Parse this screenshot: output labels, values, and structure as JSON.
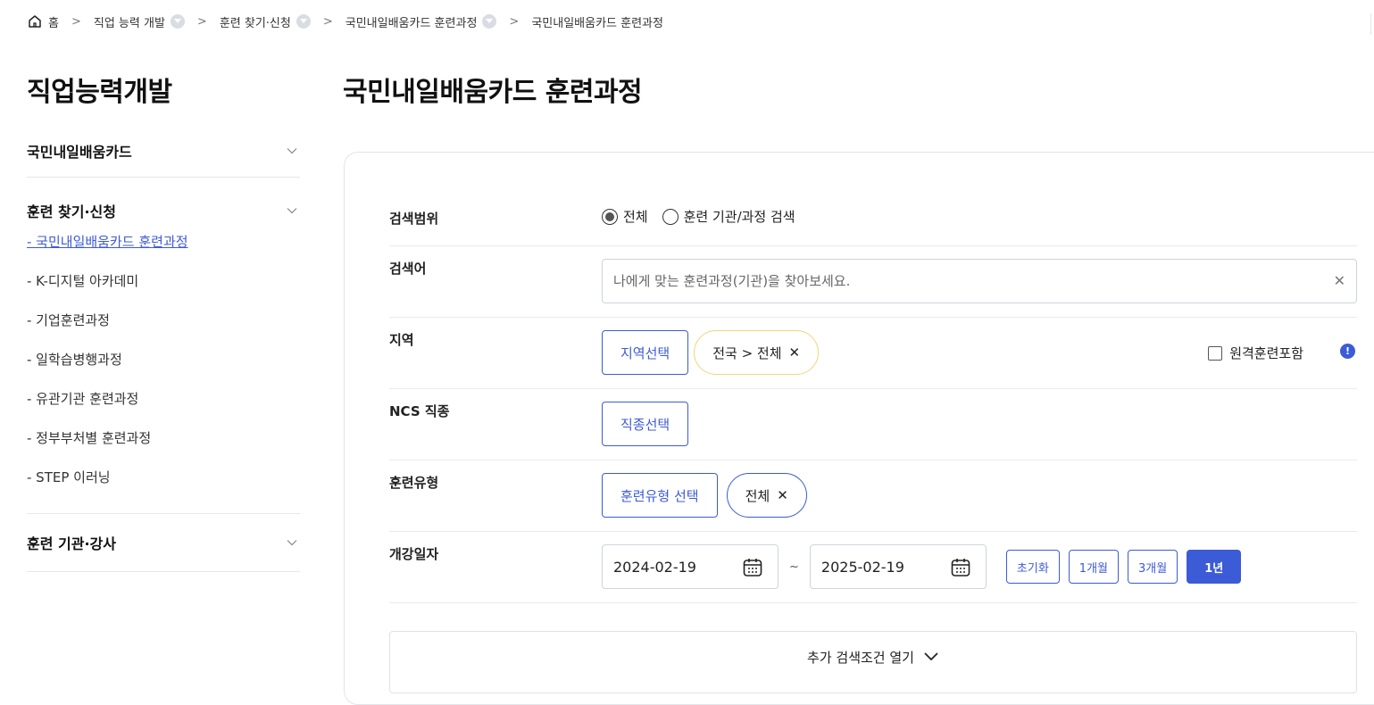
{
  "breadcrumb": {
    "home": "홈",
    "items": [
      "직업 능력 개발",
      "훈련 찾기·신청",
      "국민내일배움카드 훈련과정",
      "국민내일배움카드 훈련과정"
    ]
  },
  "sidebar": {
    "title": "직업능력개발",
    "groups": [
      {
        "label": "국민내일배움카드"
      },
      {
        "label": "훈련 찾기·신청",
        "items": [
          "- 국민내일배움카드 훈련과정",
          "- K-디지털 아카데미",
          "- 기업훈련과정",
          "- 일학습병행과정",
          "- 유관기관 훈련과정",
          "- 정부부처별 훈련과정",
          "- STEP 이러닝"
        ]
      },
      {
        "label": "훈련 기관·강사"
      }
    ]
  },
  "main": {
    "title": "국민내일배움카드 훈련과정",
    "scope": {
      "label": "검색범위",
      "options": [
        "전체",
        "훈련 기관/과정 검색"
      ],
      "selected": "전체"
    },
    "keyword": {
      "label": "검색어",
      "placeholder": "나에게 맞는 훈련과정(기관)을 찾아보세요.",
      "value": ""
    },
    "region": {
      "label": "지역",
      "button": "지역선택",
      "chip": "전국 > 전체",
      "remote_label": "원격훈련포함",
      "remote_checked": false
    },
    "ncs": {
      "label": "NCS 직종",
      "button": "직종선택"
    },
    "type": {
      "label": "훈련유형",
      "button": "훈련유형 선택",
      "chip": "전체"
    },
    "date": {
      "label": "개강일자",
      "start": "2024-02-19",
      "end": "2025-02-19",
      "sep": "~",
      "buttons": [
        "초기화",
        "1개월",
        "3개월",
        "1년"
      ],
      "active": "1년"
    },
    "more_label": "추가 검색조건 열기"
  },
  "colors": {
    "accent": "#3c5bd6",
    "chip_yellow": "#f0d67a",
    "border": "#cfd4da"
  }
}
